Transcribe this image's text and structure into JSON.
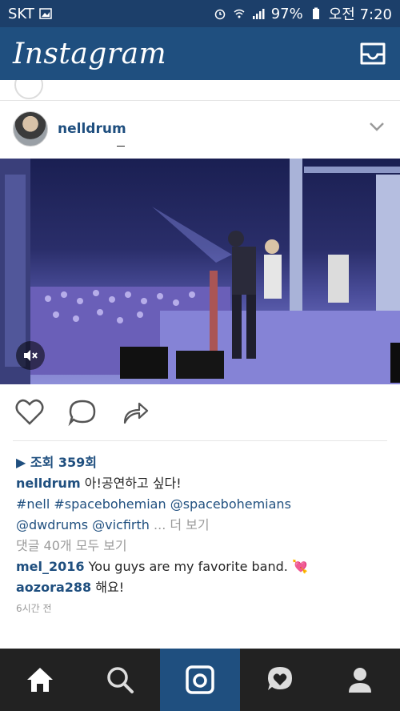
{
  "status_bar": {
    "carrier": "SKT",
    "battery": "97%",
    "time": "오전 7:20"
  },
  "header": {
    "logo": "Instagram"
  },
  "post": {
    "username": "nelldrum",
    "views": "▶ 조회 359회",
    "caption_user": "nelldrum",
    "caption_text": "아!공연하고 싶다!",
    "hashtags": [
      "#nell",
      "#spacebohemian",
      "@spacebohemians",
      "@dwdrums",
      "@vicfirth"
    ],
    "more": "... 더 보기",
    "view_comments": "댓글 40개 모두 보기",
    "comments": [
      {
        "user": "mel_2016",
        "text": "You guys are my favorite band. 💘"
      },
      {
        "user": "aozora288",
        "text": "해요!"
      }
    ],
    "timestamp": "6시간 전"
  },
  "colors": {
    "status_bg": "#1c3f6a",
    "header_bg": "#1f4f7f",
    "accent": "#1f4f7f",
    "nav_bg": "#222222"
  }
}
